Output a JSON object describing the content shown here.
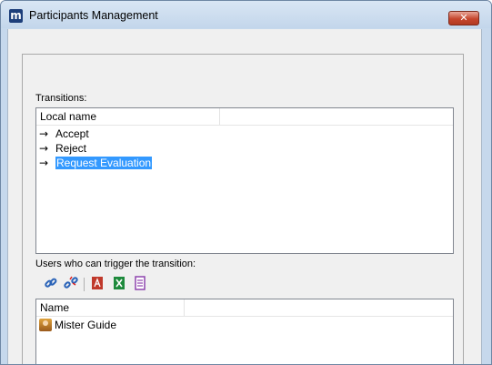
{
  "window": {
    "app_icon_letter": "m",
    "title": "Participants Management",
    "close_glyph": "✕"
  },
  "transitions": {
    "label": "Transitions:",
    "column_headers": [
      "Local name",
      ""
    ],
    "items": [
      {
        "arrow": "→",
        "name": "Accept",
        "selected": false
      },
      {
        "arrow": "→",
        "name": "Reject",
        "selected": false
      },
      {
        "arrow": "→",
        "name": "Request Evaluation",
        "selected": true
      }
    ],
    "selection_color": "#3399ff"
  },
  "users": {
    "label": "Users who can trigger the transition:",
    "toolbar": [
      {
        "icon": "link-icon"
      },
      {
        "icon": "unlink-icon"
      },
      {
        "icon": "pdf-export-icon"
      },
      {
        "icon": "excel-export-icon"
      },
      {
        "icon": "document-export-icon"
      }
    ],
    "column_headers": [
      "Name",
      ""
    ],
    "items": [
      {
        "icon": "user-icon",
        "name": "Mister Guide"
      }
    ]
  }
}
